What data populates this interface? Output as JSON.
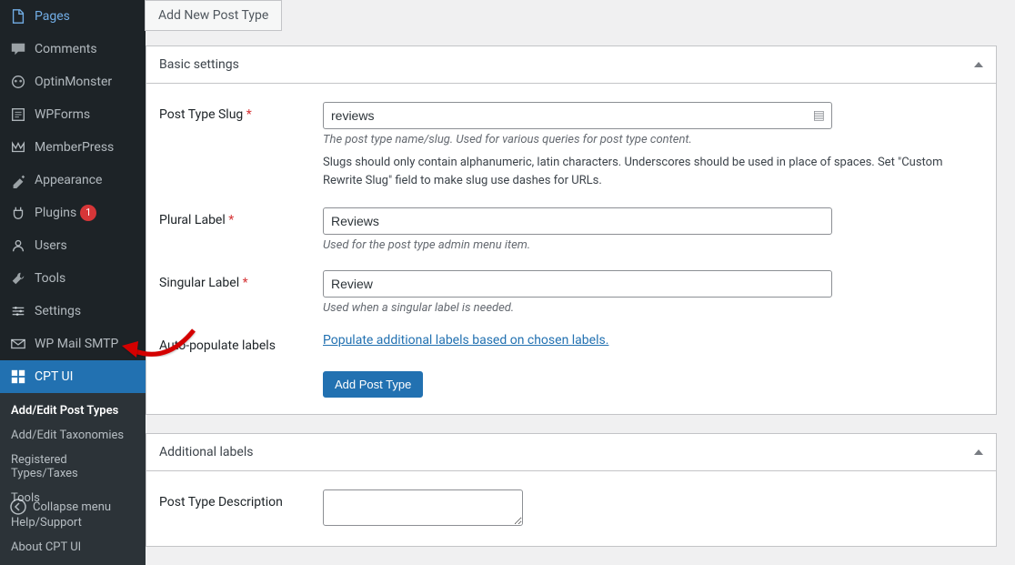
{
  "sidebar": {
    "items": [
      {
        "label": "Pages",
        "icon": "pages"
      },
      {
        "label": "Comments",
        "icon": "comments"
      },
      {
        "label": "OptinMonster",
        "icon": "optin"
      },
      {
        "label": "WPForms",
        "icon": "wpforms"
      },
      {
        "label": "MemberPress",
        "icon": "memberpress"
      },
      {
        "label": "Appearance",
        "icon": "appearance"
      },
      {
        "label": "Plugins",
        "icon": "plugins",
        "badge": "1"
      },
      {
        "label": "Users",
        "icon": "users"
      },
      {
        "label": "Tools",
        "icon": "tools"
      },
      {
        "label": "Settings",
        "icon": "settings"
      },
      {
        "label": "WP Mail SMTP",
        "icon": "mail"
      }
    ],
    "active": {
      "label": "CPT UI",
      "icon": "cptui"
    },
    "sub": [
      {
        "label": "Add/Edit Post Types",
        "current": true
      },
      {
        "label": "Add/Edit Taxonomies"
      },
      {
        "label": "Registered Types/Taxes"
      },
      {
        "label": "Tools"
      },
      {
        "label": "Help/Support"
      },
      {
        "label": "About CPT UI"
      }
    ],
    "collapse": "Collapse menu"
  },
  "tab": {
    "label": "Add New Post Type"
  },
  "panel1": {
    "title": "Basic settings",
    "slug": {
      "label": "Post Type Slug",
      "value": "reviews",
      "desc": "The post type name/slug. Used for various queries for post type content.",
      "desc2": "Slugs should only contain alphanumeric, latin characters. Underscores should be used in place of spaces. Set \"Custom Rewrite Slug\" field to make slug use dashes for URLs."
    },
    "plural": {
      "label": "Plural Label",
      "value": "Reviews",
      "desc": "Used for the post type admin menu item."
    },
    "singular": {
      "label": "Singular Label",
      "value": "Review",
      "desc": "Used when a singular label is needed."
    },
    "autopop": {
      "label": "Auto-populate labels",
      "link": "Populate additional labels based on chosen labels."
    },
    "button": "Add Post Type"
  },
  "panel2": {
    "title": "Additional labels",
    "desc": {
      "label": "Post Type Description"
    }
  }
}
